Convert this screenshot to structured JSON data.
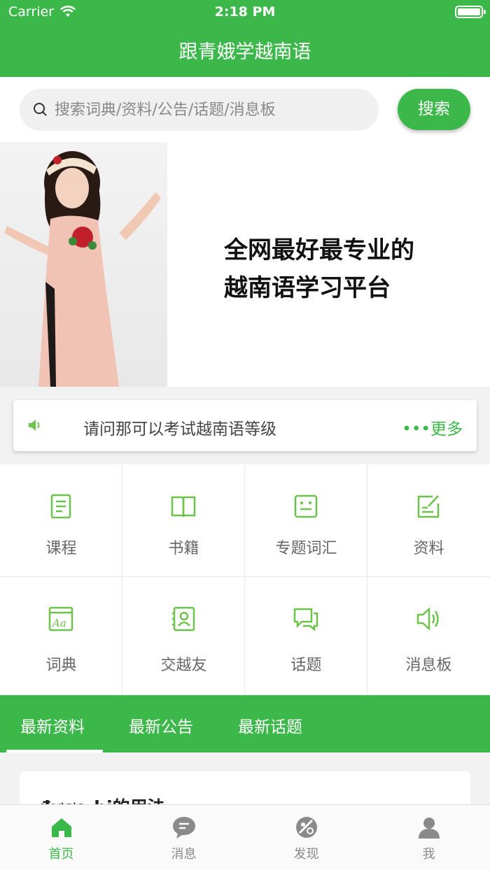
{
  "status": {
    "carrier": "Carrier",
    "time": "2:18 PM"
  },
  "nav": {
    "title": "跟青娥学越南语"
  },
  "search": {
    "placeholder": "搜索词典/资料/公告/话题/消息板",
    "button": "搜索"
  },
  "banner": {
    "line1": "全网最好最专业的",
    "line2": "越南语学习平台"
  },
  "notice": {
    "text": "请问那可以考试越南语等级",
    "more": "•••更多"
  },
  "grid": [
    {
      "label": "课程",
      "icon": "document-icon"
    },
    {
      "label": "书籍",
      "icon": "book-icon"
    },
    {
      "label": "专题词汇",
      "icon": "vocabulary-icon"
    },
    {
      "label": "资料",
      "icon": "edit-note-icon"
    },
    {
      "label": "词典",
      "icon": "dictionary-icon"
    },
    {
      "label": "交越友",
      "icon": "contact-card-icon"
    },
    {
      "label": "话题",
      "icon": "chat-bubbles-icon"
    },
    {
      "label": "消息板",
      "icon": "speaker-icon"
    }
  ],
  "tabs": [
    "最新资料",
    "最新公告",
    "最新话题"
  ],
  "card": {
    "title": "được_bị的用法"
  },
  "tabbar": [
    {
      "label": "首页",
      "icon": "home-icon",
      "active": true
    },
    {
      "label": "消息",
      "icon": "message-icon",
      "active": false
    },
    {
      "label": "发现",
      "icon": "discover-icon",
      "active": false
    },
    {
      "label": "我",
      "icon": "user-icon",
      "active": false
    }
  ],
  "colors": {
    "primary": "#3cb84a",
    "accent_icon": "#6cc24a"
  }
}
